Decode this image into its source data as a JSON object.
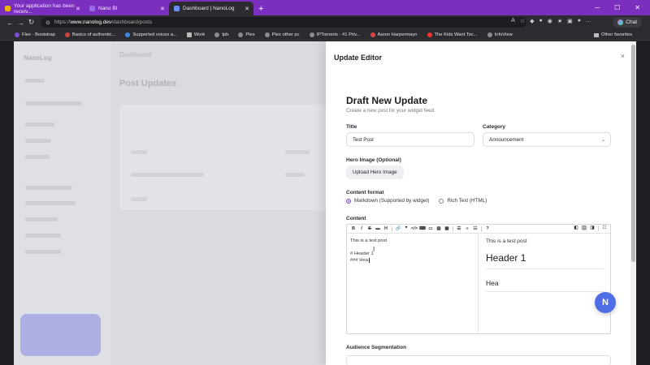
{
  "browser": {
    "tabs": [
      {
        "title": "Your application has been receiv...",
        "favicon_color": "#f0b400"
      },
      {
        "title": "Nano BI",
        "favicon_color": "#9a6be8"
      },
      {
        "title": "Dashboard | NanoLog",
        "favicon_color": "#6a8df0",
        "active": true
      }
    ],
    "new_tab": "+",
    "url_scheme": "https://",
    "url_host": "www.nanolog.dev",
    "url_path": "/dashboard/posts",
    "chat_label": "Chat",
    "bookmarks": [
      "Flex - Bootstrap",
      "Basics of authentic...",
      "Supported voices a...",
      "Work",
      "tpb",
      "Plex",
      "Plex other pc",
      "IPTorrents - #1 Priv...",
      "Aaron Harpermayn",
      "The Kids Want Tec...",
      "InfoView"
    ],
    "other_favorites": "Other favorites"
  },
  "background": {
    "logo": "NanoLog",
    "header": "Dashboard",
    "title": "Post Updates"
  },
  "editor_panel": {
    "title": "Update Editor",
    "close": "×",
    "heading": "Draft New Update",
    "subheading": "Create a new post for your widget feed.",
    "title_label": "Title",
    "title_value": "Test Post",
    "category_label": "Category",
    "category_value": "Announcement",
    "hero_label": "Hero Image (Optional)",
    "upload_button": "Upload Hero Image",
    "format_label": "Content format",
    "format_options": [
      "Markdown (Supported by widget)",
      "Rich Text (HTML)"
    ],
    "format_selected": 0,
    "content_label": "Content",
    "markdown_lines": [
      "This is a test post",
      "",
      "# Header 1",
      "### Hea"
    ],
    "preview": {
      "p": "This is a test post",
      "h1": "Header 1",
      "h3": "Hea"
    },
    "audience_label": "Audience Segmentation"
  },
  "fab_icon": "N"
}
